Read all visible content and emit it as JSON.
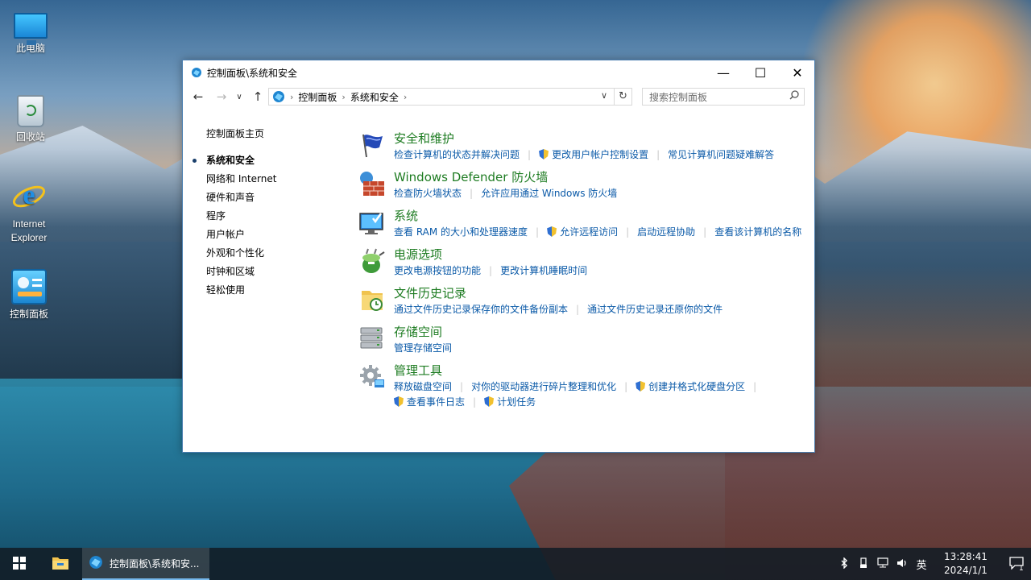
{
  "desktop": {
    "icons": [
      {
        "label": "此电脑",
        "icon": "computer-icon"
      },
      {
        "label": "回收站",
        "icon": "recycle-bin-icon"
      },
      {
        "label": "Internet Explorer",
        "icon": "internet-explorer-icon"
      },
      {
        "label": "控制面板",
        "icon": "control-panel-icon"
      }
    ]
  },
  "window": {
    "title": "控制面板\\系统和安全",
    "buttons": {
      "minimize": "—",
      "maximize": "☐",
      "close": "✕"
    },
    "address": {
      "crumbs": [
        "控制面板",
        "系统和安全"
      ],
      "refresh": "↻",
      "dropdown": "∨"
    },
    "search": {
      "placeholder": "搜索控制面板"
    },
    "nav": {
      "back": "←",
      "forward": "→",
      "recent": "∨",
      "up": "↑"
    }
  },
  "leftnav": {
    "home": "控制面板主页",
    "items": [
      {
        "label": "系统和安全",
        "current": true
      },
      {
        "label": "网络和 Internet"
      },
      {
        "label": "硬件和声音"
      },
      {
        "label": "程序"
      },
      {
        "label": "用户帐户"
      },
      {
        "label": "外观和个性化"
      },
      {
        "label": "时钟和区域"
      },
      {
        "label": "轻松使用"
      }
    ]
  },
  "categories": [
    {
      "icon": "flag-icon",
      "title": "安全和维护",
      "links": [
        {
          "text": "检查计算机的状态并解决问题"
        },
        {
          "text": "更改用户帐户控制设置",
          "shield": true
        },
        {
          "text": "常见计算机问题疑难解答"
        }
      ]
    },
    {
      "icon": "firewall-icon",
      "title": "Windows Defender 防火墙",
      "links": [
        {
          "text": "检查防火墙状态"
        },
        {
          "text": "允许应用通过 Windows 防火墙"
        }
      ]
    },
    {
      "icon": "system-icon",
      "title": "系统",
      "links": [
        {
          "text": "查看 RAM 的大小和处理器速度"
        },
        {
          "text": "允许远程访问",
          "shield": true
        },
        {
          "text": "启动远程协助"
        },
        {
          "text": "查看该计算机的名称"
        }
      ]
    },
    {
      "icon": "power-options-icon",
      "title": "电源选项",
      "links": [
        {
          "text": "更改电源按钮的功能"
        },
        {
          "text": "更改计算机睡眠时间"
        }
      ]
    },
    {
      "icon": "file-history-icon",
      "title": "文件历史记录",
      "links": [
        {
          "text": "通过文件历史记录保存你的文件备份副本"
        },
        {
          "text": "通过文件历史记录还原你的文件"
        }
      ]
    },
    {
      "icon": "storage-spaces-icon",
      "title": "存储空间",
      "links": [
        {
          "text": "管理存储空间"
        }
      ]
    },
    {
      "icon": "admin-tools-icon",
      "title": "管理工具",
      "links": [
        {
          "text": "释放磁盘空间"
        },
        {
          "text": "对你的驱动器进行碎片整理和优化"
        },
        {
          "text": "创建并格式化硬盘分区",
          "shield": true
        }
      ],
      "links2": [
        {
          "text": "查看事件日志",
          "shield": true
        },
        {
          "text": "计划任务",
          "shield": true
        }
      ]
    }
  ],
  "taskbar": {
    "active_window": "控制面板\\系统和安...",
    "tray": {
      "ime": "英",
      "time": "13:28:41",
      "date": "2024/1/1",
      "notification_count": "1"
    }
  }
}
